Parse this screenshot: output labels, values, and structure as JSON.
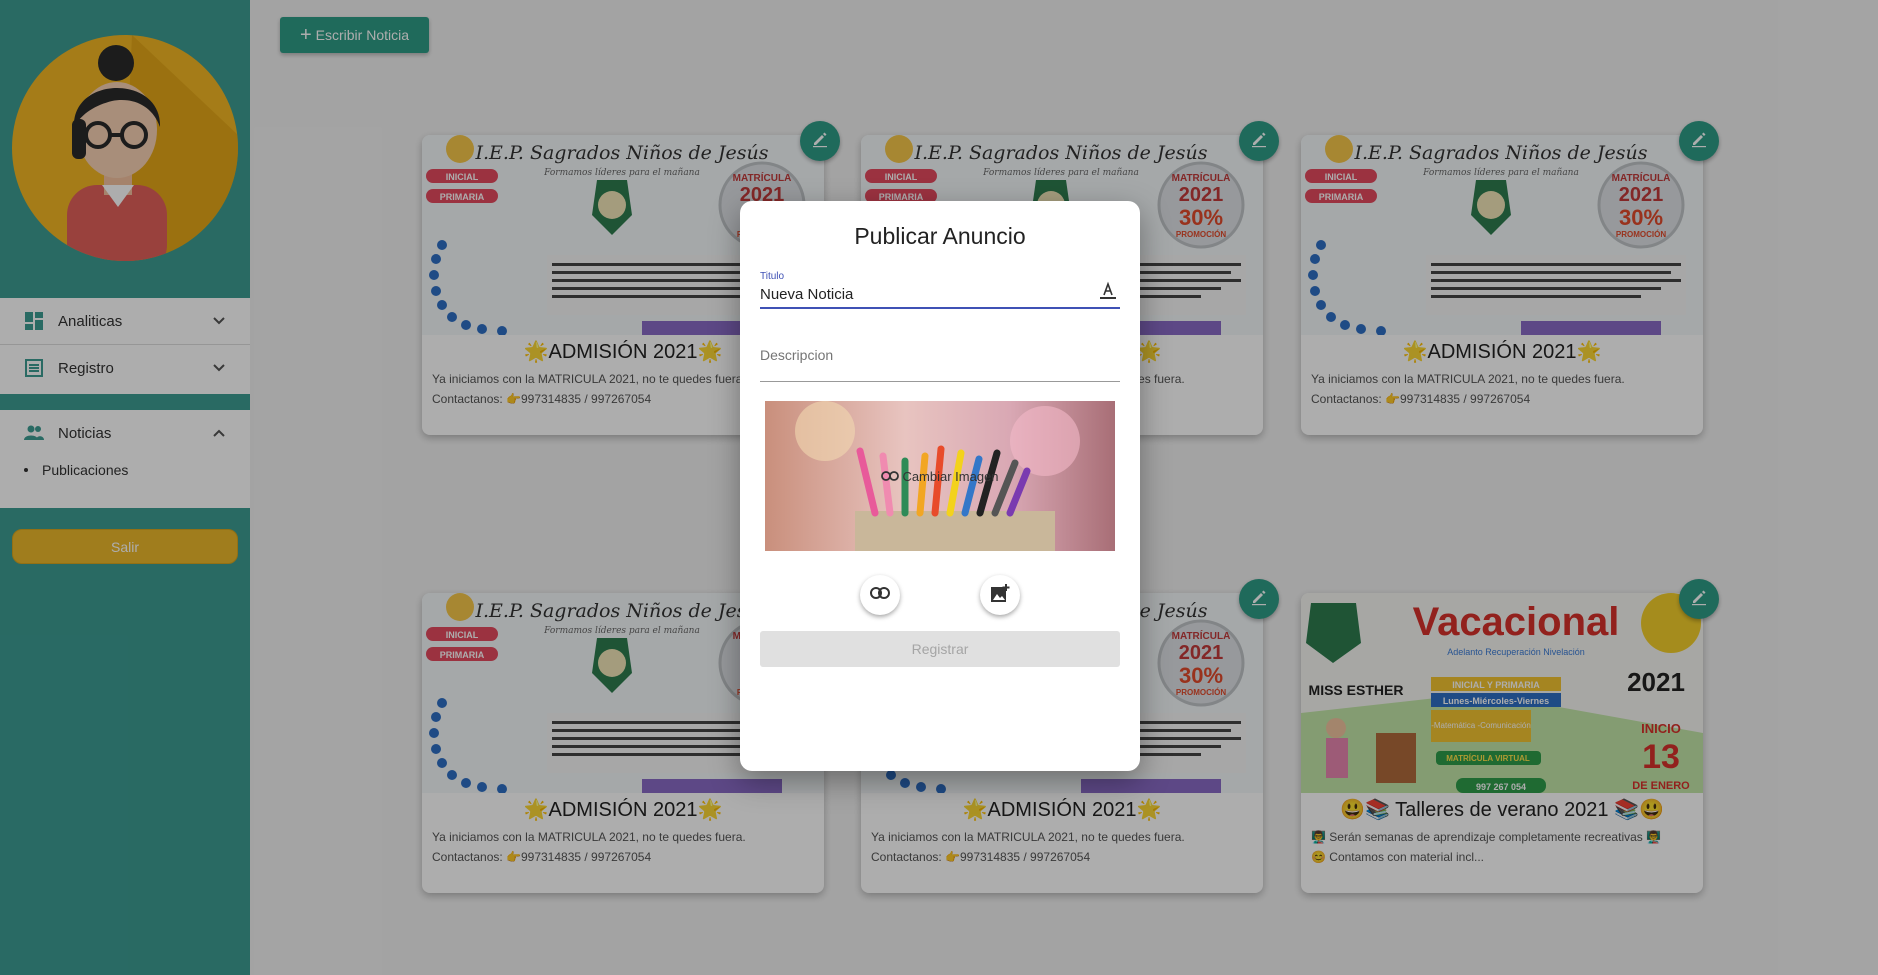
{
  "sidebar": {
    "menu": [
      {
        "label": "Analiticas",
        "icon": "dashboard-icon"
      },
      {
        "label": "Registro",
        "icon": "list-icon"
      }
    ],
    "noticias": {
      "label": "Noticias",
      "icon": "people-icon",
      "sub": [
        {
          "label": "Publicaciones"
        }
      ]
    },
    "logout_label": "Salir"
  },
  "toolbar": {
    "write_label": "Escribir Noticia"
  },
  "cards": [
    {
      "title": "🌟ADMISIÓN 2021🌟",
      "line1": "Ya iniciamos con la MATRICULA 2021, no te quedes fuera.",
      "line2": "Contactanos: 👉997314835 / 997267054"
    },
    {
      "title": "🌟ADMISIÓN 2021🌟",
      "line1": "Ya iniciamos con la MATRICULA 2021, no te quedes fuera.",
      "line2": "Contactanos: 👉997314835 / 997267054"
    },
    {
      "title": "🌟ADMISIÓN 2021🌟",
      "line1": "Ya iniciamos con la MATRICULA 2021, no te quedes fuera.",
      "line2": "Contactanos: 👉997314835 / 997267054"
    },
    {
      "title": "🌟ADMISIÓN 2021🌟",
      "line1": "Ya iniciamos con la MATRICULA 2021, no te quedes fuera.",
      "line2": "Contactanos: 👉997314835 / 997267054"
    },
    {
      "title": "🌟ADMISIÓN 2021🌟",
      "line1": "Ya iniciamos con la MATRICULA 2021, no te quedes fuera.",
      "line2": "Contactanos: 👉997314835 / 997267054"
    },
    {
      "title": "😃📚 Talleres de verano 2021 📚😃",
      "line1": "👨‍🏫 Serán semanas de aprendizaje completamente recreativas 👨‍🏫",
      "line2": "😊 Contamos con material incl..."
    }
  ],
  "card_image_text": {
    "school": "I.E.P. Sagrados Niños de Jesús",
    "motto": "Formamos líderes para el mañana",
    "levels": [
      "INICIAL",
      "PRIMARIA"
    ],
    "matricula": "MATRÍCULA",
    "year": "2021",
    "promo": "30%",
    "promo_label": "PROMOCIÓN",
    "vac_title": "Vacacional",
    "vac_sub": "Adelanto   Recuperación   Nivelación",
    "vac_teacher": "MISS ESTHER",
    "vac_level": "INICIAL Y PRIMARIA",
    "vac_days": "Lunes-Miércoles-Viernes",
    "vac_courses": "-Matemática -Comunicación",
    "vac_virtual": "MATRÍCULA VIRTUAL",
    "vac_start": "INICIO",
    "vac_day": "13",
    "vac_month": "DE ENERO",
    "vac_phone": "997 267 054"
  },
  "dialog": {
    "title": "Publicar Anuncio",
    "titulo_label": "Titulo",
    "titulo_value": "Nueva Noticia",
    "descripcion_placeholder": "Descripcion",
    "change_image_label": "Cambiar Imagen",
    "submit_label": "Registrar"
  },
  "colors": {
    "sidebar": "#3d9c93",
    "accent": "#2e9c86",
    "logout": "#ecb92c",
    "focus": "#3f51b5"
  }
}
